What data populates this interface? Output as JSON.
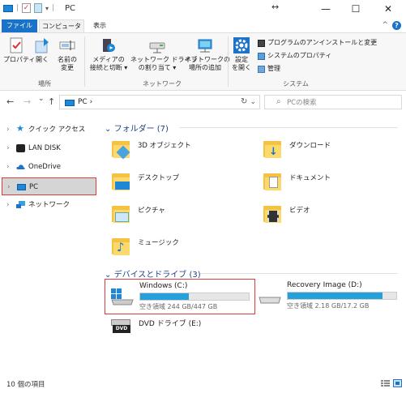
{
  "titlebar": {
    "quick_access_sep": "|",
    "title": "PC",
    "minimize": "—",
    "maximize": "☐",
    "close": "✕",
    "resize_indicator": "↔"
  },
  "ribbon_tabs": {
    "file": "ファイル",
    "computer": "コンピューター",
    "view": "表示"
  },
  "ribbon": {
    "location": {
      "properties": "プロパティ",
      "open": "開く",
      "rename_line1": "名前の",
      "rename_line2": "変更",
      "group": "場所"
    },
    "network": {
      "media_line1": "メディアの",
      "media_line2": "接続と切断 ▾",
      "map_drive_line1": "ネットワーク ドライブ",
      "map_drive_line2": "の割り当て ▾",
      "add_location_line1": "ネットワークの",
      "add_location_line2": "場所の追加",
      "group": "ネットワーク"
    },
    "system": {
      "settings_line1": "設定",
      "settings_line2": "を開く",
      "uninstall": "プログラムのアンインストールと変更",
      "system_properties": "システムのプロパティ",
      "manage": "管理",
      "group": "システム"
    }
  },
  "address": {
    "back": "←",
    "forward": "→",
    "recent": "⌄",
    "up": "↑",
    "path": "PC  ›",
    "path_prefix": "›",
    "dropdown": "⌄",
    "refresh": "↻",
    "search_placeholder": "PCの検索",
    "search_icon": "⌕"
  },
  "sidebar": {
    "items": [
      {
        "label": "クイック アクセス",
        "icon": "star-icon"
      },
      {
        "label": "LAN DISK",
        "icon": "lan-disk-icon"
      },
      {
        "label": "OneDrive",
        "icon": "cloud-icon"
      },
      {
        "label": "PC",
        "icon": "computer-icon",
        "selected": true
      },
      {
        "label": "ネットワーク",
        "icon": "network-icon"
      }
    ],
    "caret": "›"
  },
  "content": {
    "folders_header": "フォルダー (7)",
    "folders": [
      "3D オブジェクト",
      "ダウンロード",
      "デスクトップ",
      "ドキュメント",
      "ピクチャ",
      "ビデオ",
      "ミュージック"
    ],
    "devices_header": "デバイスとドライブ (3)",
    "section_chevron": "⌄",
    "drives": [
      {
        "name": "Windows (C:)",
        "free": "空き領域 244 GB/447 GB",
        "used_fraction": 0.45
      },
      {
        "name": "Recovery Image (D:)",
        "free": "空き領域 2.18 GB/17.2 GB",
        "used_fraction": 0.87
      },
      {
        "name": "DVD ドライブ (E:)",
        "dvd_badge": "DVD"
      }
    ]
  },
  "status": {
    "item_count": "10 個の項目"
  },
  "colors": {
    "accent": "#1a73c9",
    "selection_outline": "#e03a3a",
    "drive_bar": "#26a0da",
    "folder": "#f5c242"
  }
}
